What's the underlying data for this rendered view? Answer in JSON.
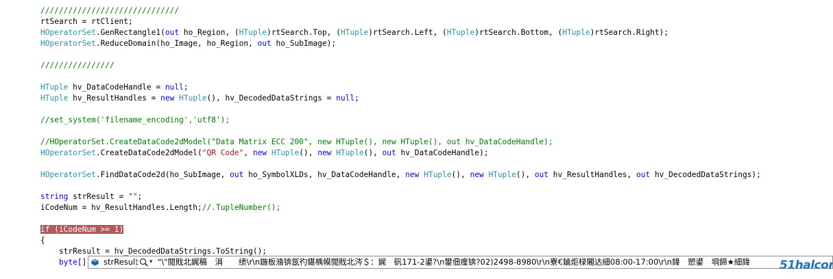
{
  "code": {
    "l1": "//////////////////////////////",
    "l2_a": "rtSearch = rtClient;",
    "l3_obj": "HOperatorSet",
    "l3_fn": ".GenRectangle1(",
    "l3_out": "out",
    "l3_b": " ho_Region, (",
    "l3_t1": "HTuple",
    "l3_c": ")rtSearch.Top, (",
    "l3_t2": "HTuple",
    "l3_d": ")rtSearch.Left, (",
    "l3_t3": "HTuple",
    "l3_e": ")rtSearch.Bottom, (",
    "l3_t4": "HTuple",
    "l3_f": ")rtSearch.Right);",
    "l4_obj": "HOperatorSet",
    "l4_a": ".ReduceDomain(ho_Image, ho_Region, ",
    "l4_out": "out",
    "l4_b": " ho_SubImage);",
    "l5": "////////////////",
    "l6_t": "HTuple",
    "l6_a": " hv_DataCodeHandle = ",
    "l6_null": "null",
    "l6_b": ";",
    "l7_t": "HTuple",
    "l7_a": " hv_ResultHandles = ",
    "l7_new": "new",
    "l7_sp": " ",
    "l7_t2": "HTuple",
    "l7_b": "(), hv_DecodedDataStrings = ",
    "l7_null": "null",
    "l7_c": ";",
    "l8": "//set_system('filename_encoding','utf8');",
    "l9": "//HOperatorSet.CreateDataCode2dModel(\"Data Matrix ECC 200\", new HTuple(), new HTuple(), out hv_DataCodeHandle);",
    "l10_obj": "HOperatorSet",
    "l10_a": ".CreateDataCode2dModel(",
    "l10_str": "\"QR Code\"",
    "l10_b": ", ",
    "l10_new1": "new",
    "l10_sp1": " ",
    "l10_t1": "HTuple",
    "l10_c": "(), ",
    "l10_new2": "new",
    "l10_sp2": " ",
    "l10_t2": "HTuple",
    "l10_d": "(), ",
    "l10_out": "out",
    "l10_e": " hv_DataCodeHandle);",
    "l11_obj": "HOperatorSet",
    "l11_a": ".FindDataCode2d(ho_SubImage, ",
    "l11_out1": "out",
    "l11_b": " ho_SymbolXLDs, hv_DataCodeHandle, ",
    "l11_new1": "new",
    "l11_sp1": " ",
    "l11_t1": "HTuple",
    "l11_c": "(), ",
    "l11_new2": "new",
    "l11_sp2": " ",
    "l11_t2": "HTuple",
    "l11_d": "(), ",
    "l11_out2": "out",
    "l11_e": " hv_ResultHandles, ",
    "l11_out3": "out",
    "l11_f": " hv_DecodedDataStrings);",
    "l12_kw": "string",
    "l12_a": " strResult = ",
    "l12_str": "\"\"",
    "l12_b": ";",
    "l13_a": "iCodeNum = hv_ResultHandles.Length;",
    "l13_cmt": "//.TupleNumber();",
    "l14": "if (iCodeNum >= 1)",
    "l15": "{",
    "l16": "    strResult = hv_DecodedDataStrings.ToString();",
    "l17_indent": "    ",
    "l17_kw": "byte",
    "l17_a": "[]"
  },
  "datatip": {
    "name": "strResult",
    "arrow": "▾",
    "value": "\"\\\"閲戝北娓稿　涓　　绩\\r\\n鍦板潃锛氬彴鍖楀幙閲戝北涔＄：娓　矾171-2鍙?\\n鐢佃瘽锛?02)2498-8980\\r\\n寮€鏀炬椂闂达細08:00-17:00\\r\\n鍏　愬鍙　埛鍗★細鍏"
  },
  "watermark": {
    "text": "51halcon.com"
  },
  "colors": {
    "keyword": "#0000ff",
    "type": "#2b91af",
    "comment": "#008000",
    "string": "#a31515",
    "highlight": "#b05a5a"
  }
}
